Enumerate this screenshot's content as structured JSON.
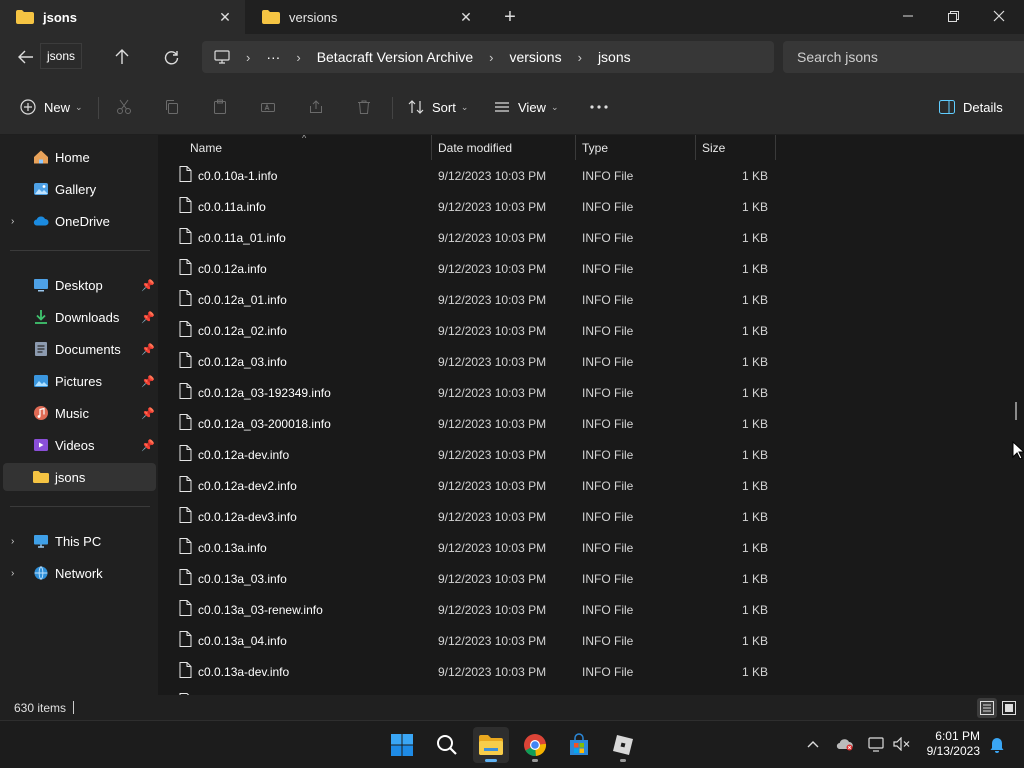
{
  "tabs": [
    {
      "label": "jsons",
      "active": true
    },
    {
      "label": "versions",
      "active": false
    }
  ],
  "window": {
    "minimize_icon": "minimize-icon",
    "maximize_icon": "restore-icon",
    "close_icon": "close-icon"
  },
  "address": {
    "back_tooltip": "jsons",
    "breadcrumbs": [
      "Betacraft Version Archive",
      "versions",
      "jsons"
    ],
    "search_placeholder": "Search jsons"
  },
  "commandbar": {
    "new_label": "New",
    "sort_label": "Sort",
    "view_label": "View",
    "details_label": "Details"
  },
  "sidebar": {
    "quick": [
      {
        "label": "Home",
        "icon": "home-icon"
      },
      {
        "label": "Gallery",
        "icon": "gallery-icon"
      },
      {
        "label": "OneDrive",
        "icon": "onedrive-icon"
      }
    ],
    "pinned": [
      {
        "label": "Desktop",
        "icon": "desktop-icon"
      },
      {
        "label": "Downloads",
        "icon": "downloads-icon"
      },
      {
        "label": "Documents",
        "icon": "documents-icon"
      },
      {
        "label": "Pictures",
        "icon": "pictures-icon"
      },
      {
        "label": "Music",
        "icon": "music-icon"
      },
      {
        "label": "Videos",
        "icon": "videos-icon"
      },
      {
        "label": "jsons",
        "icon": "folder-icon"
      }
    ],
    "devices": [
      {
        "label": "This PC",
        "icon": "this-pc-icon"
      },
      {
        "label": "Network",
        "icon": "network-icon"
      }
    ]
  },
  "columns": {
    "name": "Name",
    "date": "Date modified",
    "type": "Type",
    "size": "Size"
  },
  "files": [
    {
      "name": "c0.0.10a-1.info",
      "date": "9/12/2023 10:03 PM",
      "type": "INFO File",
      "size": "1 KB"
    },
    {
      "name": "c0.0.11a.info",
      "date": "9/12/2023 10:03 PM",
      "type": "INFO File",
      "size": "1 KB"
    },
    {
      "name": "c0.0.11a_01.info",
      "date": "9/12/2023 10:03 PM",
      "type": "INFO File",
      "size": "1 KB"
    },
    {
      "name": "c0.0.12a.info",
      "date": "9/12/2023 10:03 PM",
      "type": "INFO File",
      "size": "1 KB"
    },
    {
      "name": "c0.0.12a_01.info",
      "date": "9/12/2023 10:03 PM",
      "type": "INFO File",
      "size": "1 KB"
    },
    {
      "name": "c0.0.12a_02.info",
      "date": "9/12/2023 10:03 PM",
      "type": "INFO File",
      "size": "1 KB"
    },
    {
      "name": "c0.0.12a_03.info",
      "date": "9/12/2023 10:03 PM",
      "type": "INFO File",
      "size": "1 KB"
    },
    {
      "name": "c0.0.12a_03-192349.info",
      "date": "9/12/2023 10:03 PM",
      "type": "INFO File",
      "size": "1 KB"
    },
    {
      "name": "c0.0.12a_03-200018.info",
      "date": "9/12/2023 10:03 PM",
      "type": "INFO File",
      "size": "1 KB"
    },
    {
      "name": "c0.0.12a-dev.info",
      "date": "9/12/2023 10:03 PM",
      "type": "INFO File",
      "size": "1 KB"
    },
    {
      "name": "c0.0.12a-dev2.info",
      "date": "9/12/2023 10:03 PM",
      "type": "INFO File",
      "size": "1 KB"
    },
    {
      "name": "c0.0.12a-dev3.info",
      "date": "9/12/2023 10:03 PM",
      "type": "INFO File",
      "size": "1 KB"
    },
    {
      "name": "c0.0.13a.info",
      "date": "9/12/2023 10:03 PM",
      "type": "INFO File",
      "size": "1 KB"
    },
    {
      "name": "c0.0.13a_03.info",
      "date": "9/12/2023 10:03 PM",
      "type": "INFO File",
      "size": "1 KB"
    },
    {
      "name": "c0.0.13a_03-renew.info",
      "date": "9/12/2023 10:03 PM",
      "type": "INFO File",
      "size": "1 KB"
    },
    {
      "name": "c0.0.13a_04.info",
      "date": "9/12/2023 10:03 PM",
      "type": "INFO File",
      "size": "1 KB"
    },
    {
      "name": "c0.0.13a-dev.info",
      "date": "9/12/2023 10:03 PM",
      "type": "INFO File",
      "size": "1 KB"
    }
  ],
  "status": {
    "item_count": "630 items"
  },
  "taskbar": {
    "apps": [
      "start-icon",
      "search-icon",
      "file-explorer-icon",
      "chrome-icon",
      "microsoft-store-icon",
      "roblox-icon"
    ],
    "time": "6:01 PM",
    "date": "9/13/2023"
  },
  "colors": {
    "accent": "#60cdff",
    "folder": "#f5c443",
    "background": "#191919",
    "chrome": "#2b2b2b"
  }
}
